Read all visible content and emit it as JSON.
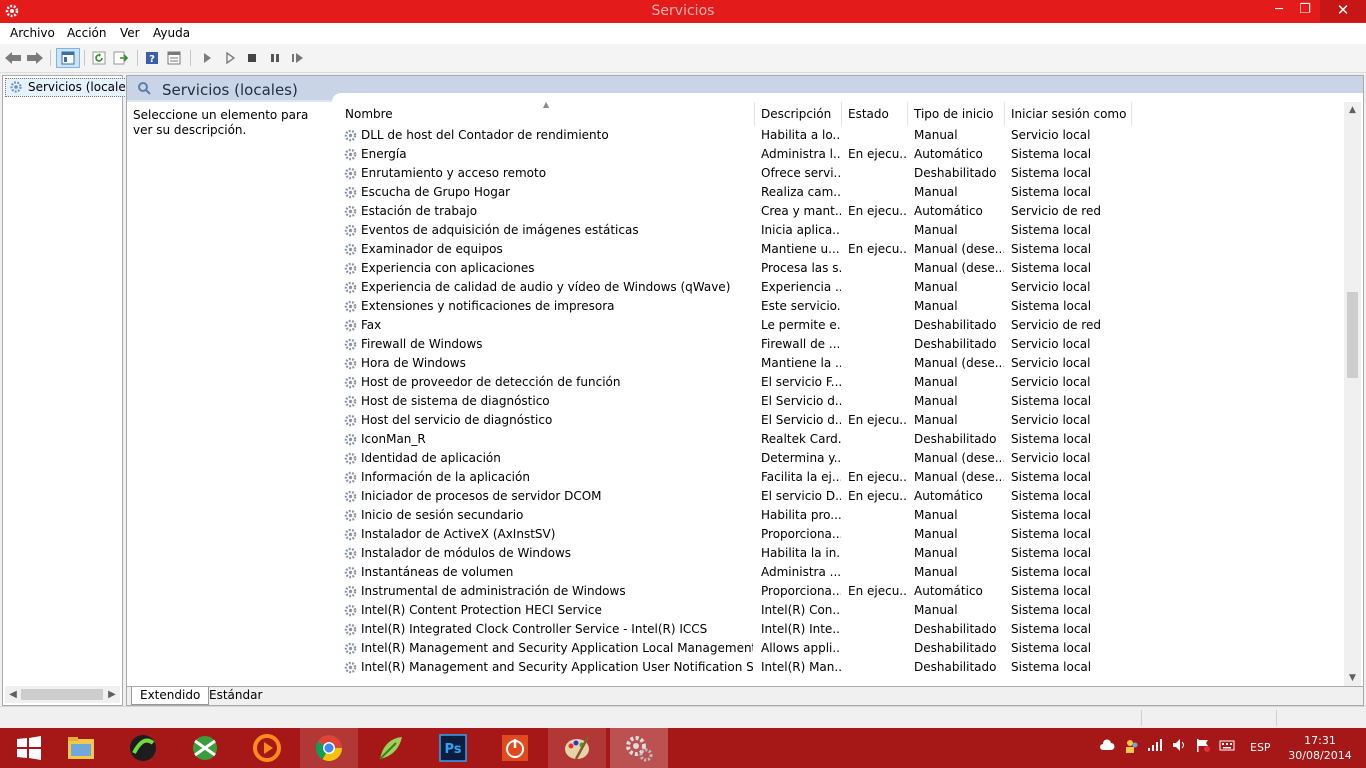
{
  "window": {
    "title": "Servicios",
    "close_glyph": "✕",
    "min_glyph": "─",
    "max_glyph": "❐"
  },
  "menu": [
    "Archivo",
    "Acción",
    "Ver",
    "Ayuda"
  ],
  "toolbar_icons": [
    "back-arrow-icon",
    "forward-arrow-icon",
    "console-tree-icon",
    "refresh-icon",
    "export-list-icon",
    "help-icon",
    "properties-icon",
    "start-service-icon",
    "start-service-alt-icon",
    "stop-service-icon",
    "pause-service-icon",
    "restart-service-icon"
  ],
  "tree": {
    "root_label": "Servicios (locales)"
  },
  "pane": {
    "title": "Servicios (locales)",
    "description": "Seleccione un elemento para ver su descripción."
  },
  "columns": [
    "Nombre",
    "Descripción",
    "Estado",
    "Tipo de inicio",
    "Iniciar sesión como"
  ],
  "services": [
    {
      "name": "DLL de host del Contador de rendimiento",
      "desc": "Habilita a lo...",
      "status": "",
      "startup": "Manual",
      "logon": "Servicio local"
    },
    {
      "name": "Energía",
      "desc": "Administra l...",
      "status": "En ejecu...",
      "startup": "Automático",
      "logon": "Sistema local"
    },
    {
      "name": "Enrutamiento y acceso remoto",
      "desc": "Ofrece servi...",
      "status": "",
      "startup": "Deshabilitado",
      "logon": "Sistema local"
    },
    {
      "name": "Escucha de Grupo Hogar",
      "desc": "Realiza cam...",
      "status": "",
      "startup": "Manual",
      "logon": "Sistema local"
    },
    {
      "name": "Estación de trabajo",
      "desc": "Crea y mant...",
      "status": "En ejecu...",
      "startup": "Automático",
      "logon": "Servicio de red"
    },
    {
      "name": "Eventos de adquisición de imágenes estáticas",
      "desc": "Inicia aplica...",
      "status": "",
      "startup": "Manual",
      "logon": "Sistema local"
    },
    {
      "name": "Examinador de equipos",
      "desc": "Mantiene u...",
      "status": "En ejecu...",
      "startup": "Manual (dese...",
      "logon": "Sistema local"
    },
    {
      "name": "Experiencia con aplicaciones",
      "desc": "Procesa las s...",
      "status": "",
      "startup": "Manual (dese...",
      "logon": "Sistema local"
    },
    {
      "name": "Experiencia de calidad de audio y vídeo de Windows (qWave)",
      "desc": "Experiencia ...",
      "status": "",
      "startup": "Manual",
      "logon": "Servicio local"
    },
    {
      "name": "Extensiones y notificaciones de impresora",
      "desc": "Este servicio...",
      "status": "",
      "startup": "Manual",
      "logon": "Sistema local"
    },
    {
      "name": "Fax",
      "desc": "Le permite e...",
      "status": "",
      "startup": "Deshabilitado",
      "logon": "Servicio de red"
    },
    {
      "name": "Firewall de Windows",
      "desc": "Firewall de ...",
      "status": "",
      "startup": "Deshabilitado",
      "logon": "Servicio local"
    },
    {
      "name": "Hora de Windows",
      "desc": "Mantiene la ...",
      "status": "",
      "startup": "Manual (dese...",
      "logon": "Servicio local"
    },
    {
      "name": "Host de proveedor de detección de función",
      "desc": "El servicio F...",
      "status": "",
      "startup": "Manual",
      "logon": "Servicio local"
    },
    {
      "name": "Host de sistema de diagnóstico",
      "desc": "El Servicio d...",
      "status": "",
      "startup": "Manual",
      "logon": "Sistema local"
    },
    {
      "name": "Host del servicio de diagnóstico",
      "desc": "El Servicio d...",
      "status": "En ejecu...",
      "startup": "Manual",
      "logon": "Servicio local"
    },
    {
      "name": "IconMan_R",
      "desc": "Realtek Card...",
      "status": "",
      "startup": "Deshabilitado",
      "logon": "Sistema local"
    },
    {
      "name": "Identidad de aplicación",
      "desc": "Determina y...",
      "status": "",
      "startup": "Manual (dese...",
      "logon": "Servicio local"
    },
    {
      "name": "Información de la aplicación",
      "desc": "Facilita la ej...",
      "status": "En ejecu...",
      "startup": "Manual (dese...",
      "logon": "Sistema local"
    },
    {
      "name": "Iniciador de procesos de servidor DCOM",
      "desc": "El servicio D...",
      "status": "En ejecu...",
      "startup": "Automático",
      "logon": "Sistema local"
    },
    {
      "name": "Inicio de sesión secundario",
      "desc": "Habilita pro...",
      "status": "",
      "startup": "Manual",
      "logon": "Sistema local"
    },
    {
      "name": "Instalador de ActiveX (AxInstSV)",
      "desc": "Proporciona...",
      "status": "",
      "startup": "Manual",
      "logon": "Sistema local"
    },
    {
      "name": "Instalador de módulos de Windows",
      "desc": "Habilita la in...",
      "status": "",
      "startup": "Manual",
      "logon": "Sistema local"
    },
    {
      "name": "Instantáneas de volumen",
      "desc": "Administra ...",
      "status": "",
      "startup": "Manual",
      "logon": "Sistema local"
    },
    {
      "name": "Instrumental de administración de Windows",
      "desc": "Proporciona...",
      "status": "En ejecu...",
      "startup": "Automático",
      "logon": "Sistema local"
    },
    {
      "name": "Intel(R) Content Protection HECI Service",
      "desc": "Intel(R) Con...",
      "status": "",
      "startup": "Manual",
      "logon": "Sistema local"
    },
    {
      "name": "Intel(R) Integrated Clock Controller Service - Intel(R) ICCS",
      "desc": "Intel(R) Inte...",
      "status": "",
      "startup": "Deshabilitado",
      "logon": "Sistema local"
    },
    {
      "name": "Intel(R) Management and Security Application Local Management Service",
      "desc": "Allows appli...",
      "status": "",
      "startup": "Deshabilitado",
      "logon": "Sistema local"
    },
    {
      "name": "Intel(R) Management and Security Application User Notification Service",
      "desc": "Intel(R) Man...",
      "status": "",
      "startup": "Deshabilitado",
      "logon": "Sistema local"
    }
  ],
  "tabs": [
    "Extendido",
    "Estándar"
  ],
  "taskbar": {
    "apps": [
      "windows-start-icon",
      "file-explorer-icon",
      "green-app-icon",
      "green-globe-icon",
      "orange-player-icon",
      "chrome-icon",
      "leaf-app-icon",
      "photoshop-icon",
      "power-app-icon",
      "paint-icon",
      "services-gear-icon"
    ],
    "photoshop_label": "Ps",
    "language": "ESP",
    "time": "17:31",
    "date": "30/08/2014"
  },
  "colors": {
    "titlebar": "#e31b1b",
    "taskbar": "#a61717",
    "pane_header": "#c9d5e6"
  }
}
